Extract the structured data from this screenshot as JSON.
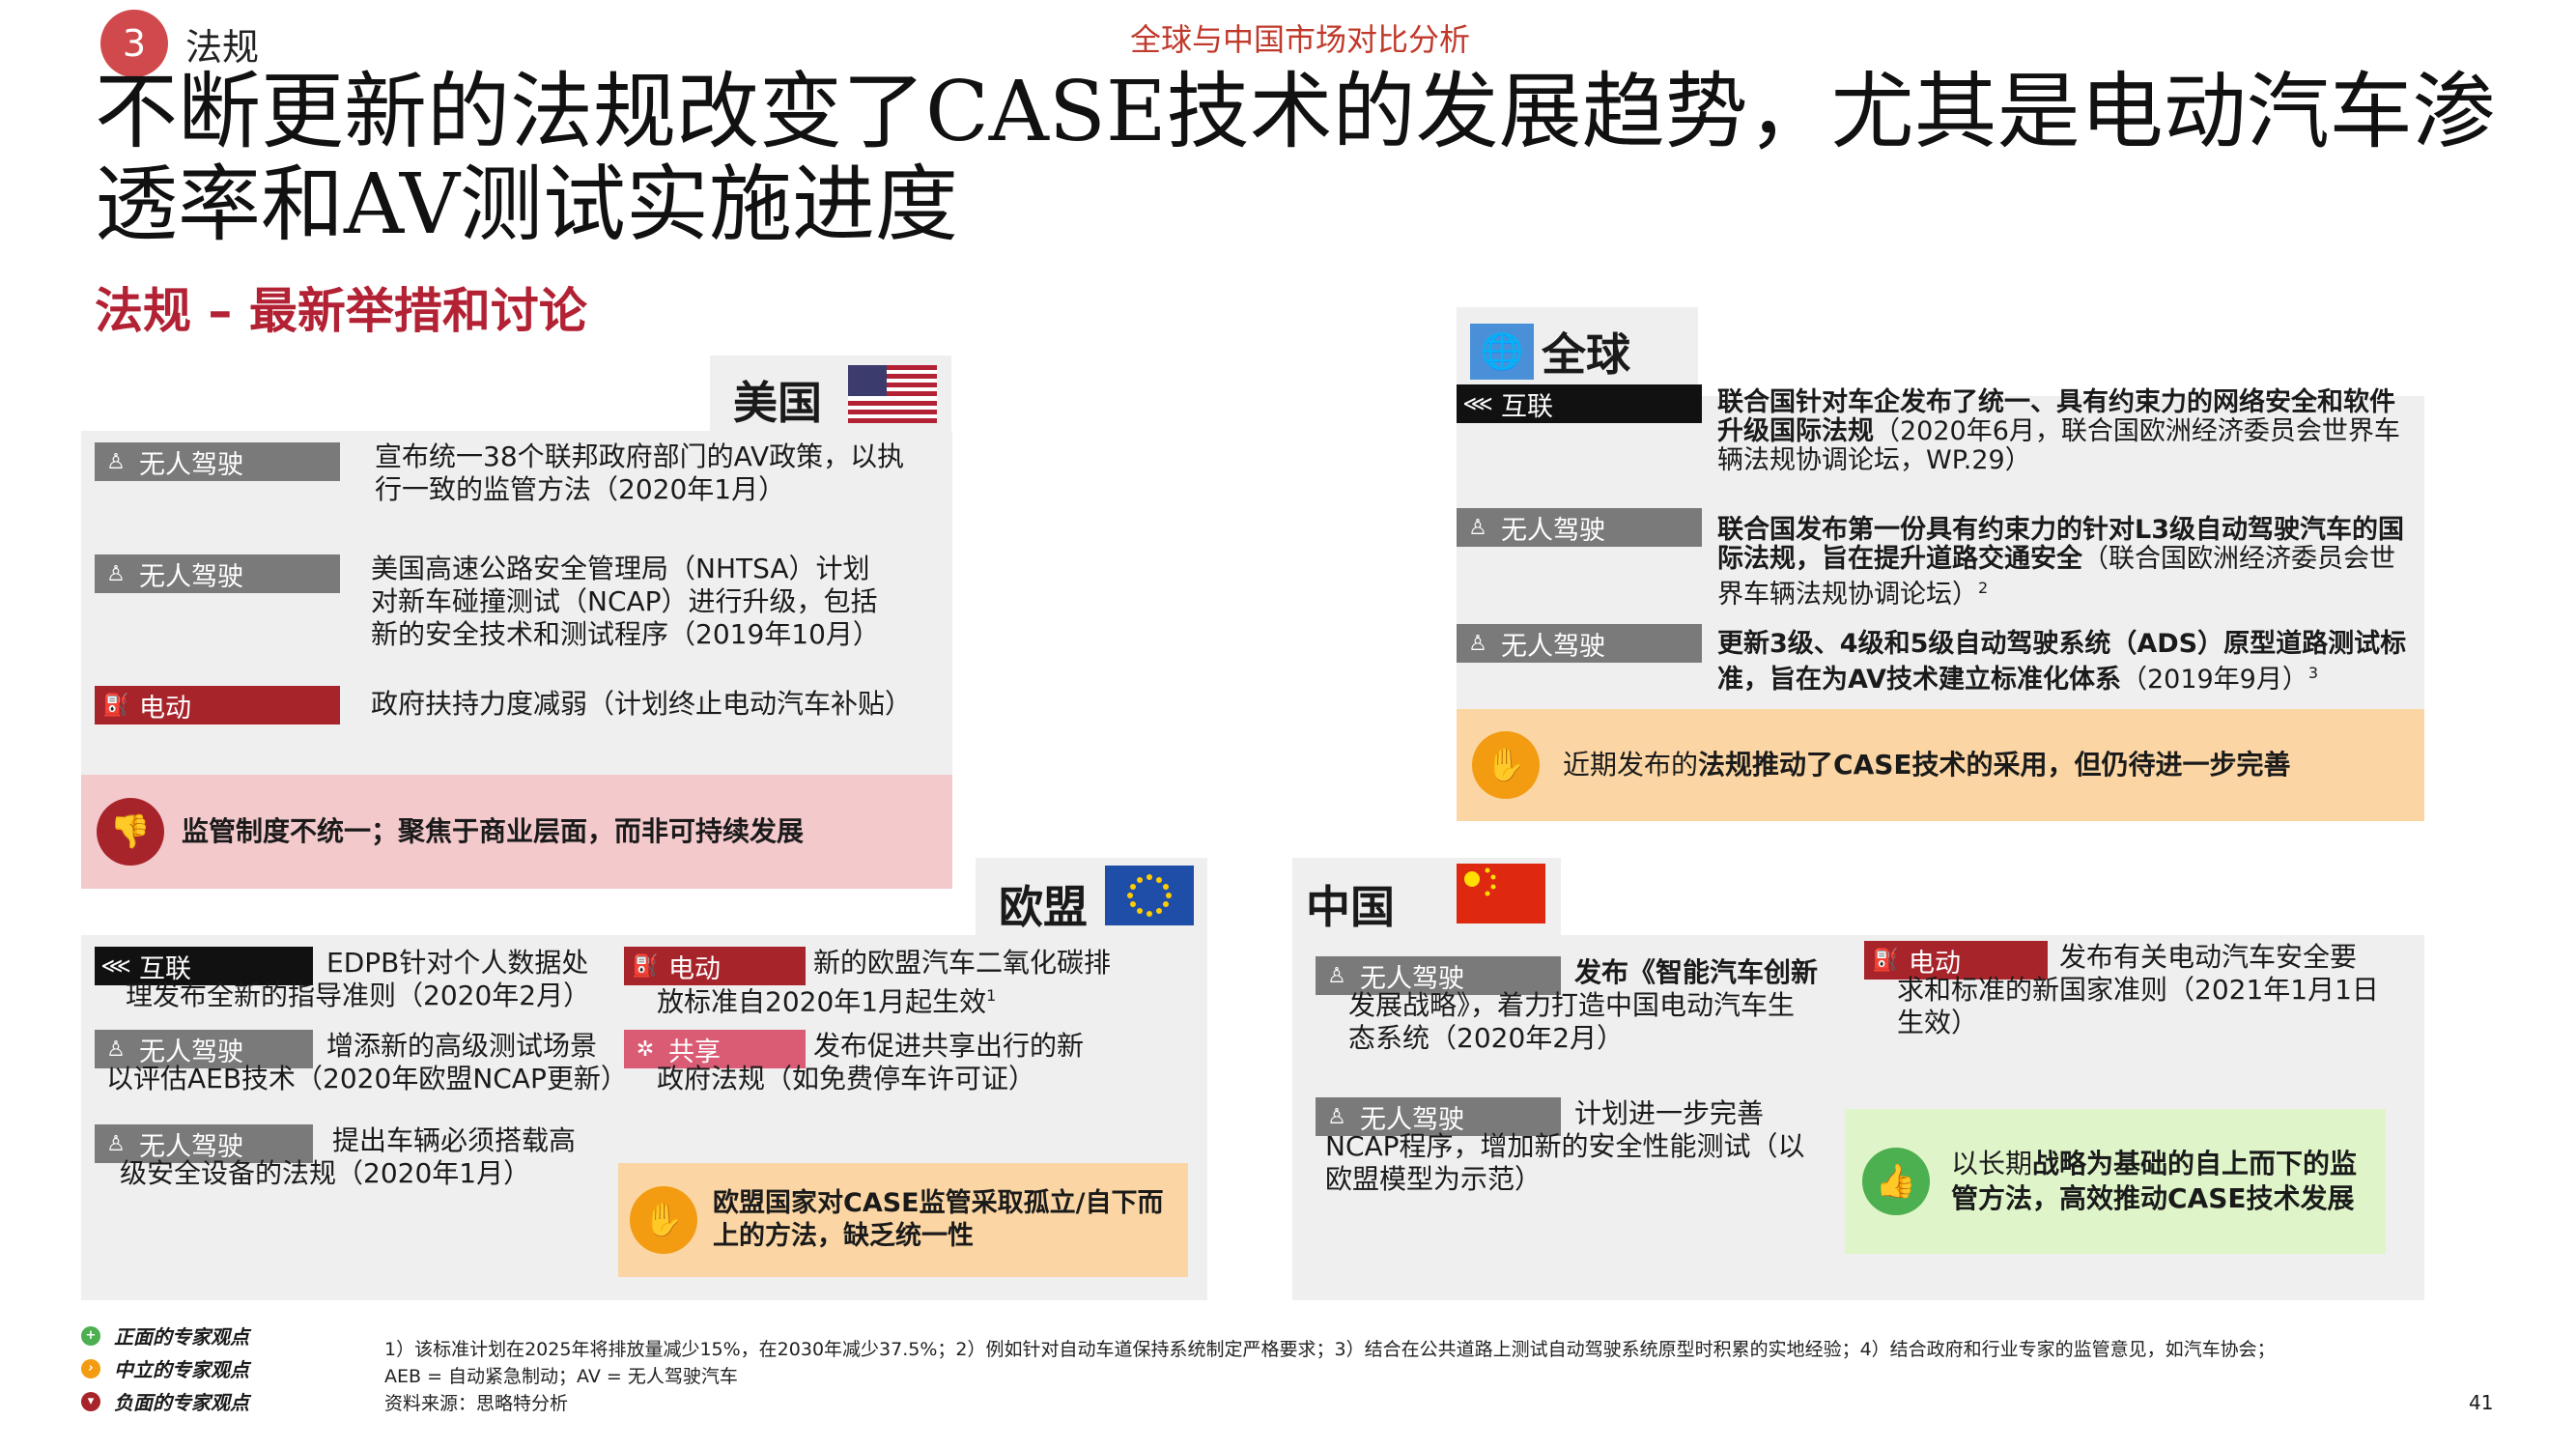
{
  "header": {
    "section_number": "3",
    "section_name": "法规",
    "top_title": "全球与中国市场对比分析",
    "headline": "不断更新的法规改变了CASE技术的发展趋势，尤其是电动汽车渗透率和AV测试实施进度",
    "subhead": "法规 – 最新举措和讨论"
  },
  "usa": {
    "name": "美国",
    "items": [
      {
        "tag": "无人驾驶",
        "text": "宣布统一38个联邦政府部门的AV政策，以执行一致的监管方法（2020年1月）"
      },
      {
        "tag": "无人驾驶",
        "text": "美国高速公路安全管理局（NHTSA）计划对新车碰撞测试（NCAP）进行升级，包括新的安全技术和测试程序（2019年10月）"
      },
      {
        "tag": "电动",
        "text": "政府扶持力度减弱（计划终止电动汽车补贴）"
      }
    ],
    "callout": "监管制度不统一；聚焦于商业层面，而非可持续发展"
  },
  "global": {
    "name": "全球",
    "items": [
      {
        "tag": "互联",
        "bold": "联合国针对车企发布了统一、具有约束力的网络安全和软件升级国际法规",
        "text": "（2020年6月，联合国欧洲经济委员会世界车辆法规协调论坛，WP.29）"
      },
      {
        "tag": "无人驾驶",
        "bold": "联合国发布第一份具有约束力的针对L3级自动驾驶汽车的国际法规，旨在提升道路交通安全",
        "text": "（联合国欧洲经济委员会世界车辆法规协调论坛）",
        "sup": "2"
      },
      {
        "tag": "无人驾驶",
        "bold": "更新3级、4级和5级自动驾驶系统（ADS）原型道路测试标准，旨在为AV技术建立标准化体系",
        "text": "（2019年9月）",
        "sup": "3"
      }
    ],
    "callout_pre": "近期发布的",
    "callout_bold": "法规推动了CASE技术的采用，但仍待进一步完善"
  },
  "eu": {
    "name": "欧盟",
    "left_items": [
      {
        "tag": "互联",
        "line1": "EDPB针对个人数据处",
        "line2": "理发布全新的指导准则（2020年2月）"
      },
      {
        "tag": "无人驾驶",
        "line1": "增添新的高级测试场景",
        "line2": "以评估AEB技术（2020年欧盟NCAP更新）"
      },
      {
        "tag": "无人驾驶",
        "line1": "提出车辆必须搭载高",
        "line2": "级安全设备的法规（2020年1月）"
      }
    ],
    "right_items": [
      {
        "tag": "电动",
        "line1": "新的欧盟汽车二氧化碳排",
        "line2": "放标准自2020年1月起生效",
        "sup": "1"
      },
      {
        "tag": "共享",
        "line1": "发布促进共享出行的新",
        "line2": "政府法规（如免费停车许可证）"
      }
    ],
    "callout": "欧盟国家对CASE监管采取孤立/自下而上的方法，缺乏统一性"
  },
  "china": {
    "name": "中国",
    "items": [
      {
        "tag": "无人驾驶",
        "line1": "发布《智能汽车创新",
        "line2": "发展战略》，着力打造中国电动汽车生",
        "line3": "态系统（2020年2月）"
      },
      {
        "tag": "无人驾驶",
        "line1": "计划进一步完善",
        "line2": "NCAP程序，增加新的安全性能测试（以",
        "line3": "欧盟模型为示范）"
      },
      {
        "tag": "电动",
        "line1": "发布有关电动汽车安全要",
        "line2": "求和标准的新国家准则（2021年1月1日",
        "line3": "生效）"
      }
    ],
    "callout_pre": "以长期",
    "callout_bold": "战略为基础的自上而下的监管方法，高效推动CASE技术发展"
  },
  "legend": [
    {
      "label": "正面的专家观点",
      "color": "#4caf50"
    },
    {
      "label": "中立的专家观点",
      "color": "#f39c12"
    },
    {
      "label": "负面的专家观点",
      "color": "#a8242b"
    }
  ],
  "footnotes": {
    "line1": "1）该标准计划在2025年将排放量减少15%，在2030年减少37.5%；2）例如针对自动车道保持系统制定严格要求；3）结合在公共道路上测试自动驾驶系统原型时积累的实地经验；4）结合政府和行业专家的监管意见，如汽车协会；",
    "line2": "AEB = 自动紧急制动；AV = 无人驾驶汽车",
    "line3": "资料来源：思略特分析"
  },
  "page_number": "41",
  "colors": {
    "accent_red": "#b22234",
    "tag_gray": "#7a7a7a",
    "tag_red": "#a8242b",
    "neutral": "#f39c12",
    "positive": "#4caf50"
  },
  "icons": {
    "autonomous": "person-seat-icon",
    "electric": "fuel-pump-icon",
    "connected": "share-icon",
    "shared": "sparkle-icon"
  }
}
